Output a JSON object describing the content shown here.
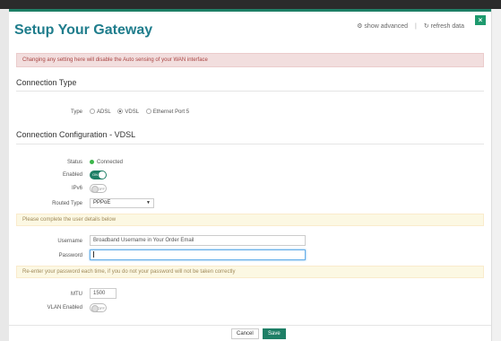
{
  "modal": {
    "title": "Setup Your Gateway",
    "show_advanced": "show advanced",
    "separator": "|",
    "refresh_data": "refresh data",
    "close": "×"
  },
  "alert": "Changing any setting here will disable the Auto sensing of your WAN interface",
  "connection_type": {
    "section_title": "Connection Type",
    "label": "Type",
    "options": [
      "ADSL",
      "VDSL",
      "Ethernet Port 5"
    ],
    "selected": "VDSL"
  },
  "config": {
    "section_title": "Connection Configuration - VDSL",
    "status_label": "Status",
    "status_value": "Connected",
    "enabled_label": "Enabled",
    "enabled_toggle": "ON",
    "ipv6_label": "IPv6",
    "ipv6_toggle": "OFF",
    "routed_type_label": "Routed Type",
    "routed_type_value": "PPPoE"
  },
  "user_note": "Please complete the user details below",
  "credentials": {
    "username_label": "Username",
    "username_value": "Broadband Username in Your Order Email",
    "password_label": "Password",
    "password_value": ""
  },
  "password_note": "Re-enter your password each time, if you do not your password will not be taken correctly",
  "advanced": {
    "mtu_label": "MTU",
    "mtu_value": "1500",
    "vlan_label": "VLAN Enabled",
    "vlan_toggle": "OFF"
  },
  "footer": {
    "cancel": "Cancel",
    "save": "Save"
  },
  "colors": {
    "accent": "#1e7f66",
    "title": "#1f7d8c",
    "alert_bg": "#f2dede",
    "note_bg": "#fcf8e3"
  }
}
